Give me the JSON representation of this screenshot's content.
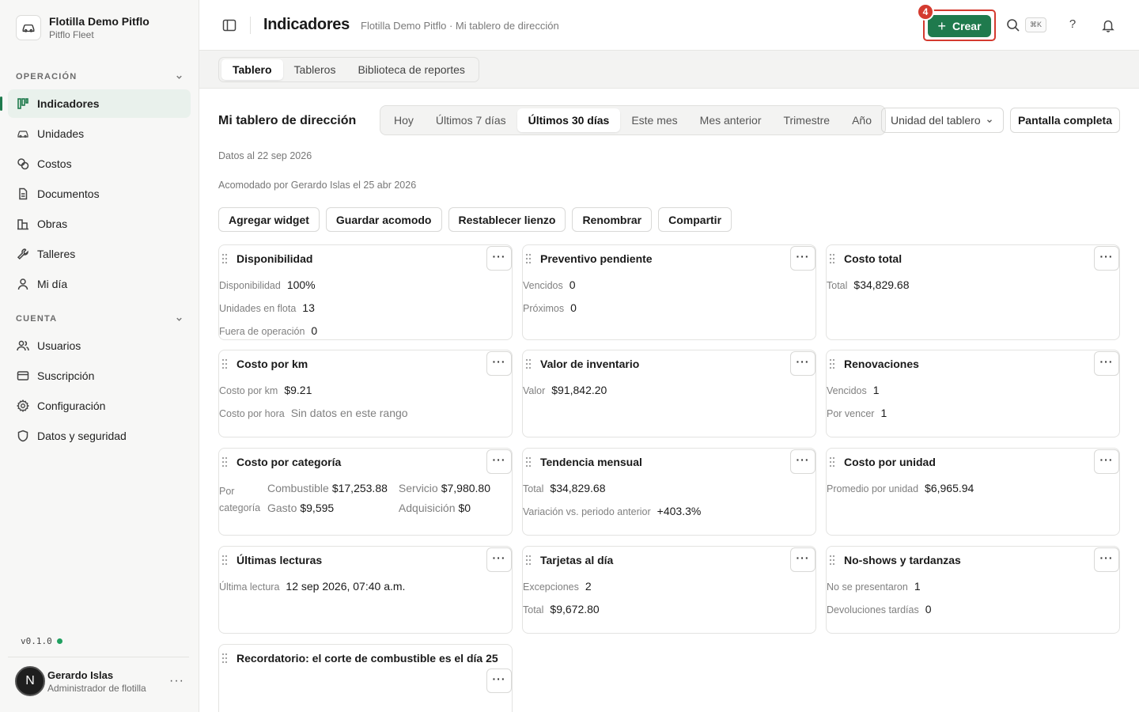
{
  "org": {
    "name": "Flotilla Demo Pitflo",
    "sub": "Pitflo Fleet"
  },
  "sidebar": {
    "sections": [
      {
        "title": "OPERACIÓN",
        "items": [
          {
            "label": "Indicadores",
            "icon": "chart-bars-icon",
            "active": true
          },
          {
            "label": "Unidades",
            "icon": "car-icon"
          },
          {
            "label": "Costos",
            "icon": "coins-icon"
          },
          {
            "label": "Documentos",
            "icon": "document-icon"
          },
          {
            "label": "Obras",
            "icon": "buildings-icon"
          },
          {
            "label": "Talleres",
            "icon": "wrench-icon"
          },
          {
            "label": "Mi día",
            "icon": "person-icon"
          }
        ]
      },
      {
        "title": "CUENTA",
        "items": [
          {
            "label": "Usuarios",
            "icon": "users-icon"
          },
          {
            "label": "Suscripción",
            "icon": "credit-card-icon"
          },
          {
            "label": "Configuración",
            "icon": "gear-icon"
          },
          {
            "label": "Datos y seguridad",
            "icon": "shield-icon"
          }
        ]
      }
    ],
    "version": "v0.1.0",
    "user": {
      "initial": "N",
      "name": "Gerardo Islas",
      "role": "Administrador de flotilla"
    }
  },
  "topbar": {
    "title": "Indicadores",
    "breadcrumb": "Flotilla Demo Pitflo · Mi tablero de dirección",
    "create_label": "Crear",
    "badge": "4",
    "shortcut": "⌘K",
    "help": "?"
  },
  "tabs": [
    "Tablero",
    "Tableros",
    "Biblioteca de reportes"
  ],
  "board": {
    "title": "Mi tablero de dirección",
    "ranges": [
      "Hoy",
      "Últimos 7 días",
      "Últimos 30 días",
      "Este mes",
      "Mes anterior",
      "Trimestre",
      "Año"
    ],
    "active_range": 2,
    "unit_select": "Unidad del tablero",
    "fullscreen": "Pantalla completa",
    "data_as_of": "Datos al 22 sep 2026",
    "arranged_by": "Acomodado por Gerardo Islas el 25 abr 2026",
    "actions": [
      "Agregar widget",
      "Guardar acomodo",
      "Restablecer lienzo",
      "Renombrar",
      "Compartir"
    ]
  },
  "widgets": {
    "disponibilidad": {
      "title": "Disponibilidad",
      "rows": [
        {
          "label": "Disponibilidad",
          "value": "100%"
        },
        {
          "label": "Unidades en flota",
          "value": "13"
        },
        {
          "label": "Fuera de operación",
          "value": "0"
        }
      ]
    },
    "preventivo": {
      "title": "Preventivo pendiente",
      "rows": [
        {
          "label": "Vencidos",
          "value": "0"
        },
        {
          "label": "Próximos",
          "value": "0"
        }
      ]
    },
    "costo_total": {
      "title": "Costo total",
      "rows": [
        {
          "label": "Total",
          "value": "$34,829.68"
        }
      ]
    },
    "costo_km": {
      "title": "Costo por km",
      "rows": [
        {
          "label": "Costo por km",
          "value": "$9.21"
        },
        {
          "label": "Costo por hora",
          "value": "Sin datos en este rango"
        }
      ]
    },
    "inventario": {
      "title": "Valor de inventario",
      "rows": [
        {
          "label": "Valor",
          "value": "$91,842.20"
        }
      ]
    },
    "renovaciones": {
      "title": "Renovaciones",
      "rows": [
        {
          "label": "Vencidos",
          "value": "1"
        },
        {
          "label": "Por vencer",
          "value": "1"
        }
      ]
    },
    "costo_categoria": {
      "title": "Costo por categoría",
      "label": "Por categoría",
      "cells": [
        {
          "k": "Combustible",
          "v": "$17,253.88"
        },
        {
          "k": "Servicio",
          "v": "$7,980.80"
        },
        {
          "k": "Gasto",
          "v": "$9,595"
        },
        {
          "k": "Adquisición",
          "v": "$0"
        }
      ]
    },
    "tendencia": {
      "title": "Tendencia mensual",
      "rows": [
        {
          "label": "Total",
          "value": "$34,829.68"
        },
        {
          "label": "Variación vs. periodo anterior",
          "value": "+403.3%"
        }
      ]
    },
    "costo_unidad": {
      "title": "Costo por unidad",
      "rows": [
        {
          "label": "Promedio por unidad",
          "value": "$6,965.94"
        }
      ]
    },
    "lecturas": {
      "title": "Últimas lecturas",
      "rows": [
        {
          "label": "Última lectura",
          "value": "12 sep 2026, 07:40 a.m."
        }
      ]
    },
    "tarjetas": {
      "title": "Tarjetas al día",
      "rows": [
        {
          "label": "Excepciones",
          "value": "2"
        },
        {
          "label": "Total",
          "value": "$9,672.80"
        }
      ]
    },
    "noshows": {
      "title": "No-shows y tardanzas",
      "rows": [
        {
          "label": "No se presentaron",
          "value": "1"
        },
        {
          "label": "Devoluciones tardías",
          "value": "0"
        }
      ]
    },
    "recordatorio": {
      "title": "Recordatorio: el corte de combustible es el día 25"
    }
  },
  "more_glyph": "···",
  "colors": {
    "accent": "#1f7a4d",
    "highlight": "#d43a2f",
    "active_nav_bg": "#e9f1ec"
  }
}
